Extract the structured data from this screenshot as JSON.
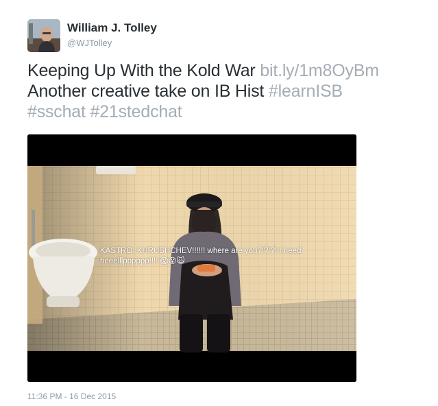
{
  "author": {
    "name": "William J. Tolley",
    "handle": "@WJTolley"
  },
  "tweet": {
    "line1_text": "Keeping Up With the Kold War ",
    "link": "bit.ly/1m8OyBm",
    "line2_text": "Another creative take on IB Hist ",
    "hashtags": [
      "#learnISB",
      "#sschat",
      "#21stedchat"
    ]
  },
  "media": {
    "caption": "KASTRO: KHRUSHCHEV!!!!!! where are you?!?!?! I need heeelllpppppp!!!! 😱😵🙀"
  },
  "timestamp": "11:36 PM - 16 Dec 2015",
  "colors": {
    "name": "#292f33",
    "muted": "#8899a6",
    "link": "#a4adb5"
  }
}
